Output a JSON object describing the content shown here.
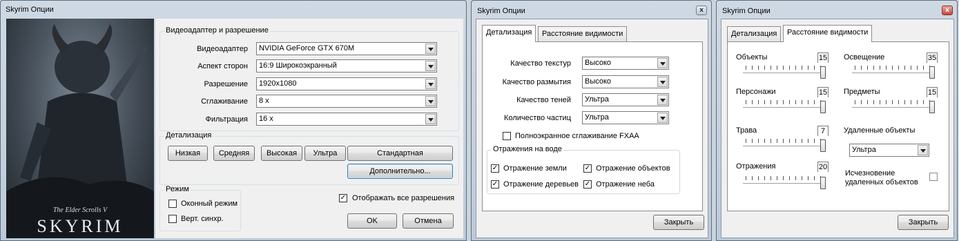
{
  "window1": {
    "title": "Skyrim Опции",
    "art": {
      "small": "The Elder Scrolls V",
      "big": "SKYRIM"
    },
    "adapter_group": "Видеоадаптер и разрешение",
    "rows": [
      {
        "label": "Видеоадаптер",
        "value": "NVIDIA GeForce GTX 670M"
      },
      {
        "label": "Аспект сторон",
        "value": "16:9 Широкоэкранный"
      },
      {
        "label": "Разрешение",
        "value": "1920x1080"
      },
      {
        "label": "Сглаживание",
        "value": "8 x"
      },
      {
        "label": "Фильтрация",
        "value": "16 x"
      }
    ],
    "detail_group": "Детализация",
    "detail_buttons": {
      "low": "Низкая",
      "medium": "Средняя",
      "high": "Высокая",
      "ultra": "Ультра",
      "standard": "Стандартная",
      "advanced": "Дополнительно..."
    },
    "mode_group": "Режим",
    "windowed": {
      "label": "Оконный режим",
      "checked": false
    },
    "vsync": {
      "label": "Верт. синхр.",
      "checked": false
    },
    "show_all": {
      "label": "Отображать все разрешения",
      "checked": true
    },
    "ok": "OK",
    "cancel": "Отмена"
  },
  "window2": {
    "title": "Skyrim  Опции",
    "tabs": [
      "Детализация",
      "Расстояние видимости"
    ],
    "rows": [
      {
        "label": "Качество текстур",
        "value": "Высоко"
      },
      {
        "label": "Качество размытия",
        "value": "Высоко"
      },
      {
        "label": "Качество теней",
        "value": "Ультра"
      },
      {
        "label": "Количество частиц",
        "value": "Ультра"
      }
    ],
    "fxaa": {
      "label": "Полноэкранное сглаживание FXAA",
      "checked": false
    },
    "water_group": "Отражения на воде",
    "water": {
      "land": {
        "label": "Отражение земли",
        "checked": true
      },
      "objects": {
        "label": "Отражение объектов",
        "checked": true
      },
      "trees": {
        "label": "Отражение деревьев",
        "checked": true
      },
      "sky": {
        "label": "Отражение неба",
        "checked": true
      }
    },
    "close": "Закрыть"
  },
  "window3": {
    "title": "Skyrim Опции",
    "tabs": [
      "Детализация",
      "Расстояние видимости"
    ],
    "sliders": {
      "objects": {
        "label": "Объекты",
        "value": "15",
        "level": 1.0
      },
      "lighting": {
        "label": "Освещение",
        "value": "35",
        "level": 1.0
      },
      "actors": {
        "label": "Персонажи",
        "value": "15",
        "level": 1.0
      },
      "items": {
        "label": "Предметы",
        "value": "15",
        "level": 1.0
      },
      "grass": {
        "label": "Трава",
        "value": "7",
        "level": 1.0
      },
      "reflections": {
        "label": "Отражения",
        "value": "20",
        "level": 1.0
      }
    },
    "distant_label": "Удаленные объекты",
    "distant_value": "Ультра",
    "fade_label_1": "Исчезновение",
    "fade_label_2": "удаленных объектов",
    "fade_checked": false,
    "close": "Закрыть"
  }
}
